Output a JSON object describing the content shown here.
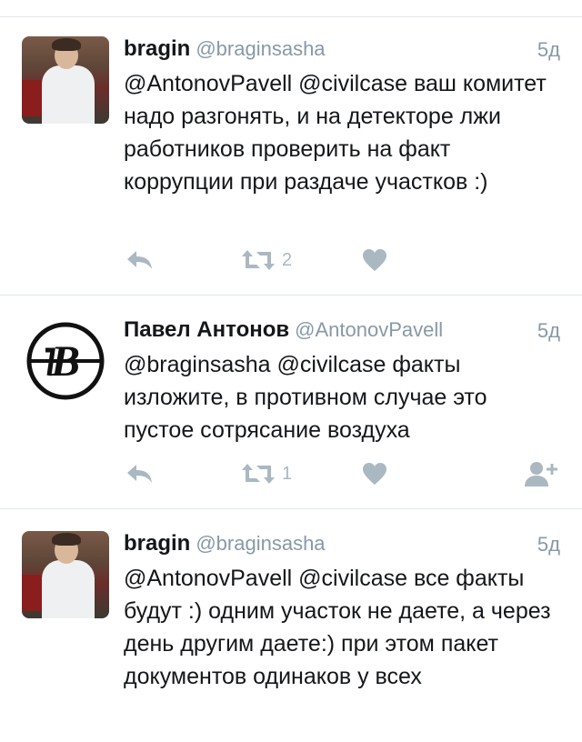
{
  "tweets": [
    {
      "name": "bragin",
      "handle": "@braginsasha",
      "time": "5д",
      "text": "@AntonovPavell @civilcase ваш комитет надо разгонять, и на детекторе лжи работников проверить на факт коррупции при раздаче участков :)",
      "retweets": "2",
      "avatar": "user-photo-avatar"
    },
    {
      "name": "Павел Антонов",
      "handle": "@AntonovPavell",
      "time": "5д",
      "text": "@braginsasha @civilcase факты изложите, в противном случае это пустое сотрясание воздуха",
      "retweets": "1",
      "avatar": "logo-avatar"
    },
    {
      "name": "bragin",
      "handle": "@braginsasha",
      "time": "5д",
      "text": "@AntonovPavell @civilcase все факты будут :) одним участок не даете, а через день другим даете:) при этом пакет документов одинаков у всех",
      "avatar": "user-photo-avatar"
    }
  ],
  "icons": {
    "reply": "reply-icon",
    "retweet": "retweet-icon",
    "like": "heart-icon",
    "follow": "follow-user-icon"
  },
  "colors": {
    "icon_gray": "#aab8c2",
    "handle_gray": "#8899a6",
    "text": "#14171a",
    "divider": "#e1e8ed"
  }
}
